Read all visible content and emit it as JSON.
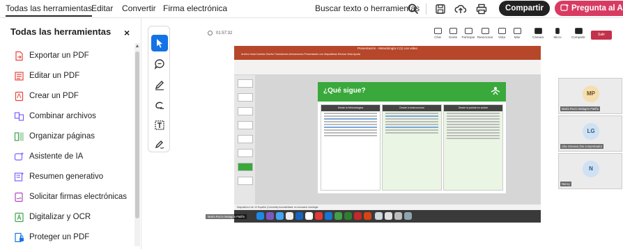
{
  "topbar": {
    "tabs": [
      "Todas las herramientas",
      "Editar",
      "Convertir",
      "Firma electrónica"
    ],
    "search_label": "Buscar texto o herramientas",
    "share_label": "Compartir",
    "ask_label": "Pregunta al As"
  },
  "sidebar": {
    "title": "Todas las herramientas",
    "close_glyph": "×",
    "items": [
      {
        "label": "Exportar un PDF",
        "color": "#e8443a"
      },
      {
        "label": "Editar un PDF",
        "color": "#e8443a"
      },
      {
        "label": "Crear un PDF",
        "color": "#e8443a"
      },
      {
        "label": "Combinar archivos",
        "color": "#7b61ff"
      },
      {
        "label": "Organizar páginas",
        "color": "#3fa34d"
      },
      {
        "label": "Asistente de IA",
        "color": "#7b61ff"
      },
      {
        "label": "Resumen generativo",
        "color": "#7b61ff"
      },
      {
        "label": "Solicitar firmas electrónicas",
        "color": "#b146c2"
      },
      {
        "label": "Digitalizar y OCR",
        "color": "#3fa34d"
      },
      {
        "label": "Proteger un PDF",
        "color": "#1473e6"
      }
    ]
  },
  "meeting": {
    "elapsed": "01:57:32",
    "toolbar": [
      "Chat",
      "Gente",
      "Participar",
      "Reaccionar",
      "Vista",
      "Más",
      "Cámara",
      "Micro",
      "Compartir"
    ],
    "leave_label": "Salir",
    "presenter_name": "María Rocío Malagón Patiño",
    "participants": [
      {
        "initials": "MP",
        "name": "María Rocío Malagón Patiño",
        "color": "#f5deb0"
      },
      {
        "initials": "LG",
        "name": "Lilia Giovana (No comprobado)",
        "color": "#cfe1f2"
      },
      {
        "initials": "N",
        "name": "Nancy",
        "color": "#cfe1f2"
      }
    ]
  },
  "presentation": {
    "window_title": "Presentación - Metodología 2 (1) con video",
    "menu": "Archivo   Inicio   Insertar   Diseño   Transiciones   Animaciones   Presentación con diapositivas   Revisar   Vista   Ayuda",
    "slide_title": "¿Qué sigue?",
    "columns": [
      "Desde la Metodológica",
      "Desde lo instruccional",
      "Desde la puesta en acción"
    ],
    "status": "Diapositiva 4 de 10   Español (Colombia)   Accesibilidad: es necesario investigar"
  },
  "colors": {
    "accent_blue": "#1473e6",
    "share_button": "#222222",
    "ask_button": "#d83b62",
    "ppt_red": "#b7472a",
    "slide_green": "#39a93b"
  }
}
